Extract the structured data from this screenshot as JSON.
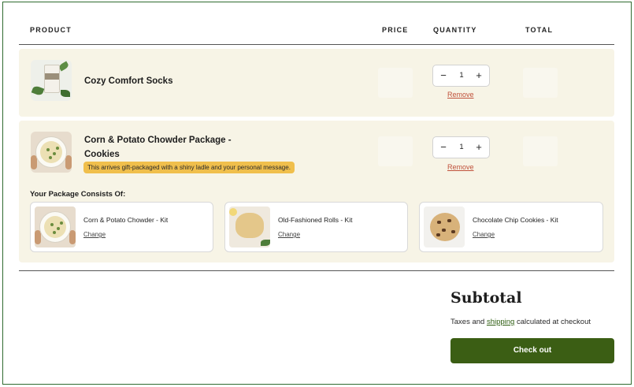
{
  "table_header": {
    "product": "PRODUCT",
    "price": "PRICE",
    "quantity": "QUANTITY",
    "total": "TOTAL"
  },
  "items": [
    {
      "title": "Cozy Comfort Socks",
      "quantity": "1",
      "remove_label": "Remove",
      "qty_minus": "−",
      "qty_plus": "+",
      "image_icon": "socks-package-image"
    },
    {
      "title_line1": "Corn & Potato Chowder Package -",
      "title_line2": "Cookies",
      "badge": "This arrives gift-packaged with a shiny ladle and your personal message.",
      "quantity": "1",
      "remove_label": "Remove",
      "qty_minus": "−",
      "qty_plus": "+",
      "image_icon": "chowder-bowl-image",
      "package_heading": "Your Package Consists Of:",
      "package_items": [
        {
          "name": "Corn & Potato Chowder - Kit",
          "change_label": "Change",
          "image_icon": "chowder-bowl-image"
        },
        {
          "name": "Old-Fashioned Rolls - Kit",
          "change_label": "Change",
          "image_icon": "roll-image"
        },
        {
          "name": "Chocolate Chip Cookies - Kit",
          "change_label": "Change",
          "image_icon": "cookie-image"
        }
      ]
    }
  ],
  "summary": {
    "subtotal_title": "Subtotal",
    "tax_prefix": "Taxes and ",
    "shipping_link": "shipping",
    "tax_suffix": " calculated at checkout",
    "checkout_label": "Check out"
  },
  "colors": {
    "card_bg": "#f7f4e6",
    "badge": "#f0bf4c",
    "remove_link": "#c0513b",
    "checkout_button": "#3b5e14",
    "frame_border": "#2f6b2f"
  }
}
